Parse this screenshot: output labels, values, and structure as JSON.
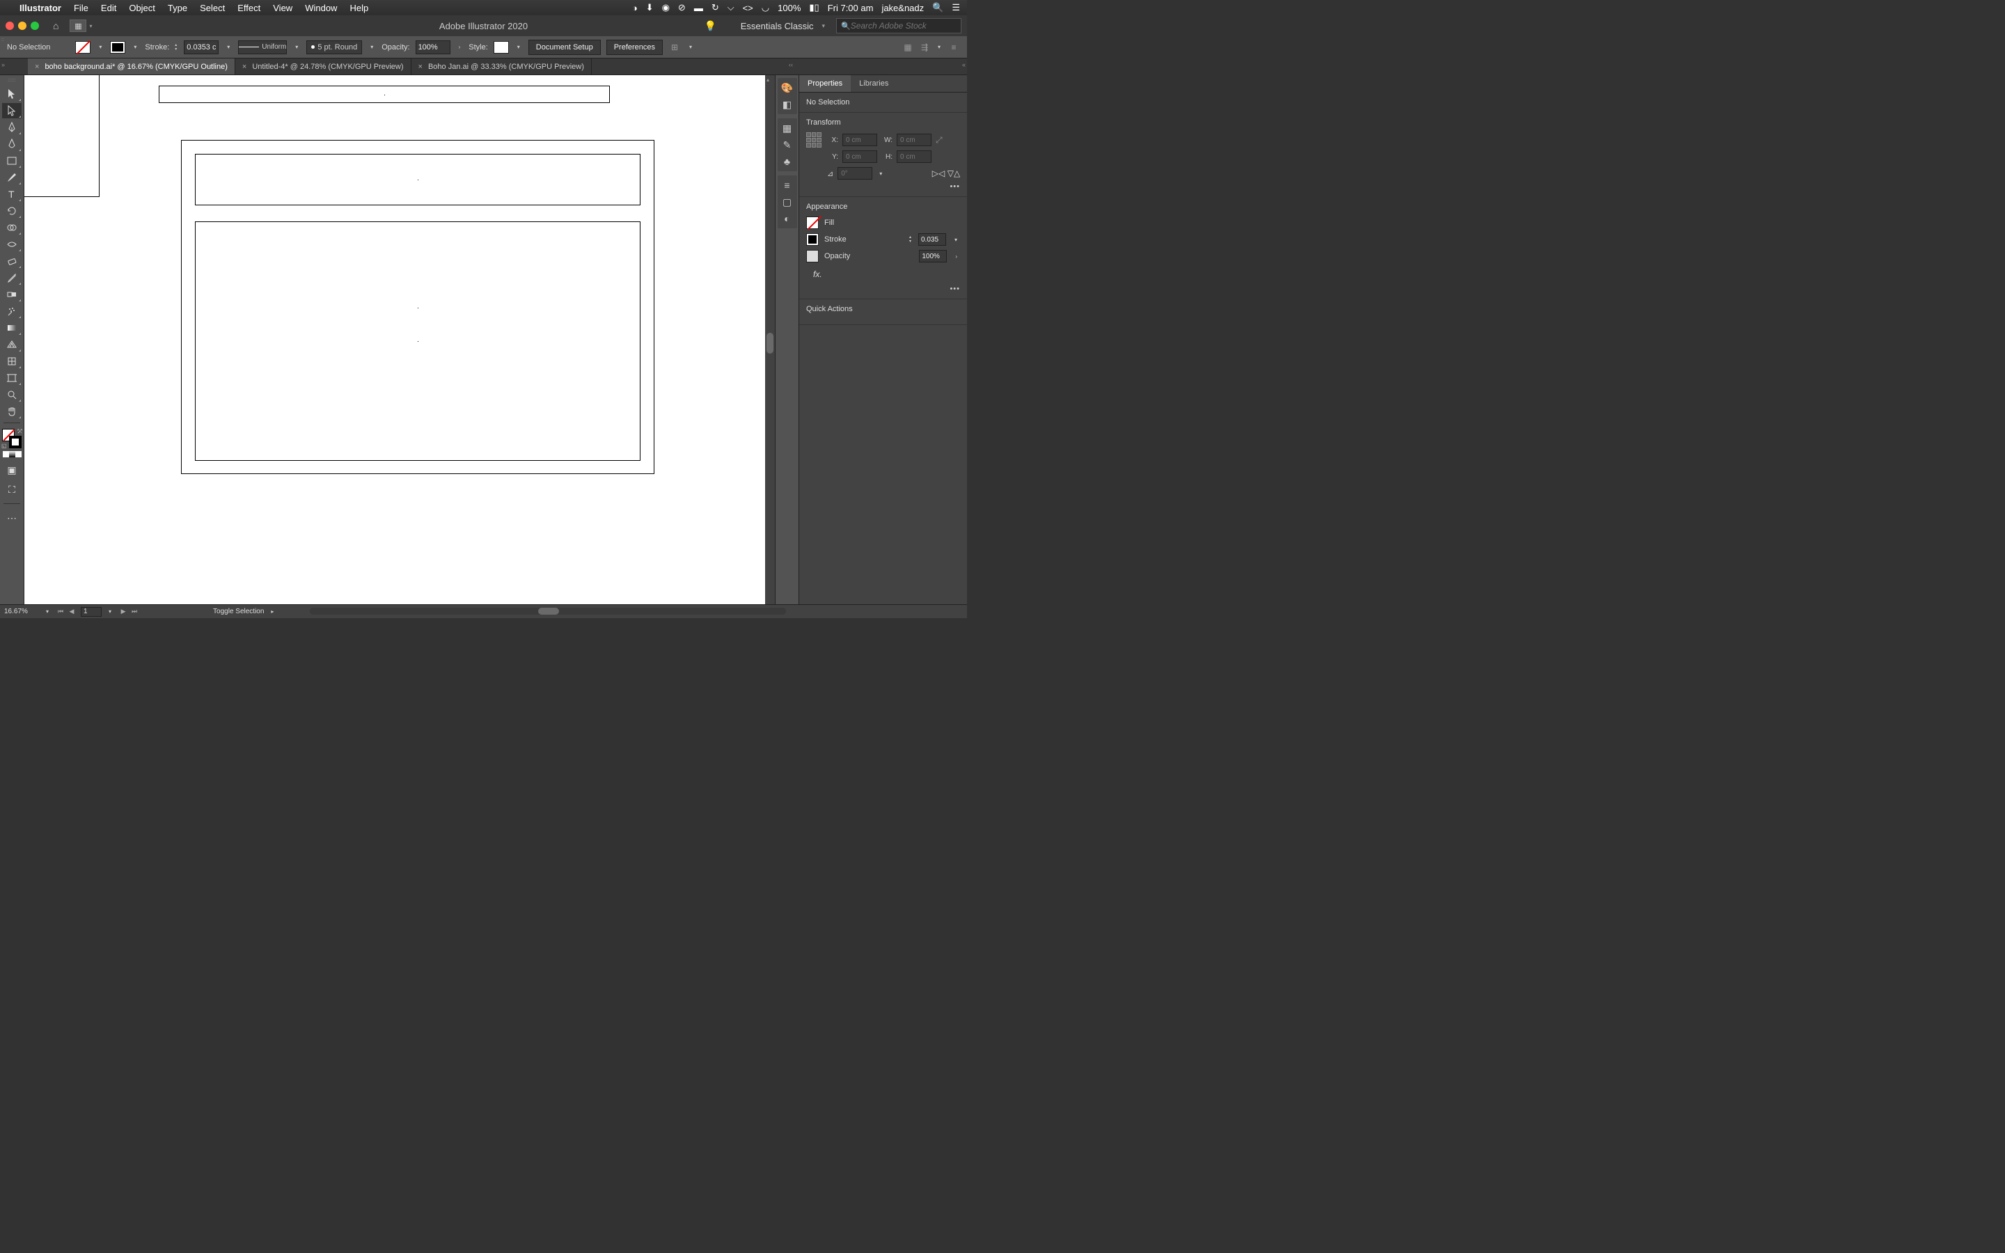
{
  "menubar": {
    "app": "Illustrator",
    "items": [
      "File",
      "Edit",
      "Object",
      "Type",
      "Select",
      "Effect",
      "View",
      "Window",
      "Help"
    ],
    "battery": "100%",
    "time": "Fri 7:00 am",
    "user": "jake&nadz"
  },
  "titlebar": {
    "apptitle": "Adobe Illustrator 2020",
    "workspace": "Essentials Classic",
    "search_placeholder": "Search Adobe Stock"
  },
  "controlbar": {
    "selection": "No Selection",
    "stroke_label": "Stroke:",
    "stroke_val": "0.0353 c",
    "profile": "Uniform",
    "brush": "5 pt. Round",
    "opacity_label": "Opacity:",
    "opacity_val": "100%",
    "style_label": "Style:",
    "doc_setup": "Document Setup",
    "prefs": "Preferences"
  },
  "tabs": [
    {
      "label": "boho background.ai* @ 16.67% (CMYK/GPU Outline)",
      "active": true
    },
    {
      "label": "Untitled-4* @ 24.78% (CMYK/GPU Preview)",
      "active": false
    },
    {
      "label": "Boho Jan.ai @ 33.33% (CMYK/GPU Preview)",
      "active": false
    }
  ],
  "props": {
    "tabs": [
      "Properties",
      "Libraries"
    ],
    "nosel": "No Selection",
    "transform_title": "Transform",
    "x_label": "X:",
    "y_label": "Y:",
    "w_label": "W:",
    "h_label": "H:",
    "x_val": "0 cm",
    "y_val": "0 cm",
    "w_val": "0 cm",
    "h_val": "0 cm",
    "rotate_val": "0°",
    "appearance_title": "Appearance",
    "fill_label": "Fill",
    "stroke_label": "Stroke",
    "stroke_val": "0.035",
    "opacity_label": "Opacity",
    "opacity_val": "100%",
    "fx": "fx.",
    "quick": "Quick Actions"
  },
  "statusbar": {
    "zoom": "16.67%",
    "artboard": "1",
    "msg": "Toggle Selection"
  }
}
